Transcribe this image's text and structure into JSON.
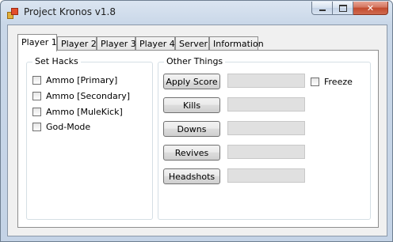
{
  "window": {
    "title": "Project Kronos v1.8",
    "caption": {
      "minimize": "—",
      "maximize": "□",
      "close": "✕"
    }
  },
  "tabs": [
    {
      "label": "Player 1",
      "active": true
    },
    {
      "label": "Player 2",
      "active": false
    },
    {
      "label": "Player 3",
      "active": false
    },
    {
      "label": "Player 4",
      "active": false
    },
    {
      "label": "Server",
      "active": false
    },
    {
      "label": "Information",
      "active": false
    }
  ],
  "set_hacks": {
    "title": "Set Hacks",
    "options": [
      {
        "label": "Ammo [Primary]",
        "checked": false
      },
      {
        "label": "Ammo [Secondary]",
        "checked": false
      },
      {
        "label": "Ammo [MuleKick]",
        "checked": false
      },
      {
        "label": "God-Mode",
        "checked": false
      }
    ]
  },
  "other_things": {
    "title": "Other Things",
    "buttons": [
      {
        "label": "Apply Score",
        "value": ""
      },
      {
        "label": "Kills",
        "value": ""
      },
      {
        "label": "Downs",
        "value": ""
      },
      {
        "label": "Revives",
        "value": ""
      },
      {
        "label": "Headshots",
        "value": ""
      }
    ],
    "freeze": {
      "label": "Freeze",
      "checked": false
    }
  }
}
